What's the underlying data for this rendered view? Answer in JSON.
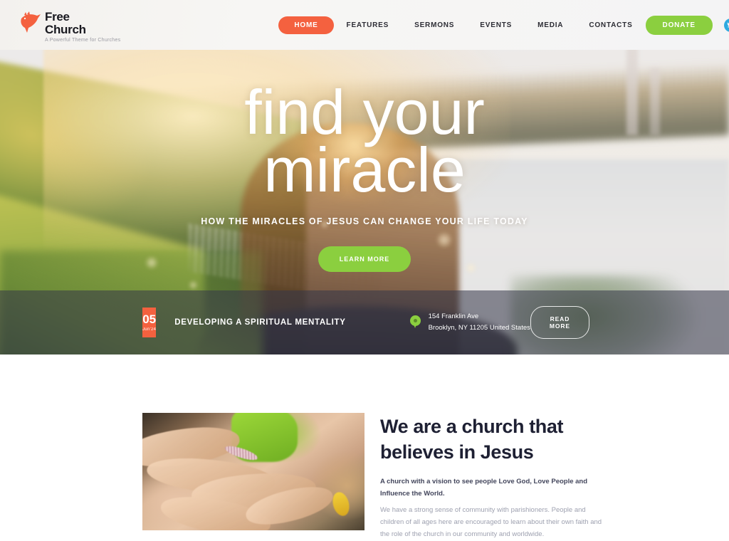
{
  "header": {
    "logo": {
      "line1": "Free",
      "line2": "Church",
      "tagline": "A Powerful Theme for Churches",
      "icon": "dove-logo-icon"
    },
    "nav": [
      {
        "label": "HOME",
        "active": true
      },
      {
        "label": "FEATURES",
        "active": false
      },
      {
        "label": "SERMONS",
        "active": false
      },
      {
        "label": "EVENTS",
        "active": false
      },
      {
        "label": "MEDIA",
        "active": false
      },
      {
        "label": "CONTACTS",
        "active": false
      }
    ],
    "donate_label": "DONATE",
    "socials": [
      {
        "name": "twitter-icon",
        "color": "#2eaae0"
      },
      {
        "name": "facebook-icon",
        "color": "#3a569f"
      },
      {
        "name": "instagram-icon",
        "color": "#5a7c96"
      },
      {
        "name": "pinterest-icon",
        "color": "#f0568f"
      }
    ]
  },
  "hero": {
    "title_line1": "find your",
    "title_line2": "miracle",
    "subtitle": "HOW THE MIRACLES OF JESUS CAN CHANGE YOUR LIFE TODAY",
    "cta_label": "LEARN MORE"
  },
  "event_bar": {
    "date_day": "05",
    "date_month": "Jun'24",
    "title": "DEVELOPING A SPIRITUAL MENTALITY",
    "location_icon": "map-pin-icon",
    "address_line1": "154 Franklin Ave",
    "address_line2": "Brooklyn, NY 11205 United States",
    "read_more_label": "READ MORE"
  },
  "about": {
    "image_alt": "hands-stacked-together-photo",
    "title": "We are a church that believes in Jesus",
    "lead": "A church with a vision to see people Love God, Love People and Influence the World.",
    "body": "We have a strong sense of community with parishioners. People and children of all ages here are encouraged to learn about their own faith and the role of the church in our community and worldwide."
  },
  "colors": {
    "accent_orange": "#f4613f",
    "accent_green": "#8bcf3f",
    "dark_text": "#1e2033",
    "muted_text": "#9ea1b0",
    "overlay": "rgba(52,54,72,0.55)"
  }
}
